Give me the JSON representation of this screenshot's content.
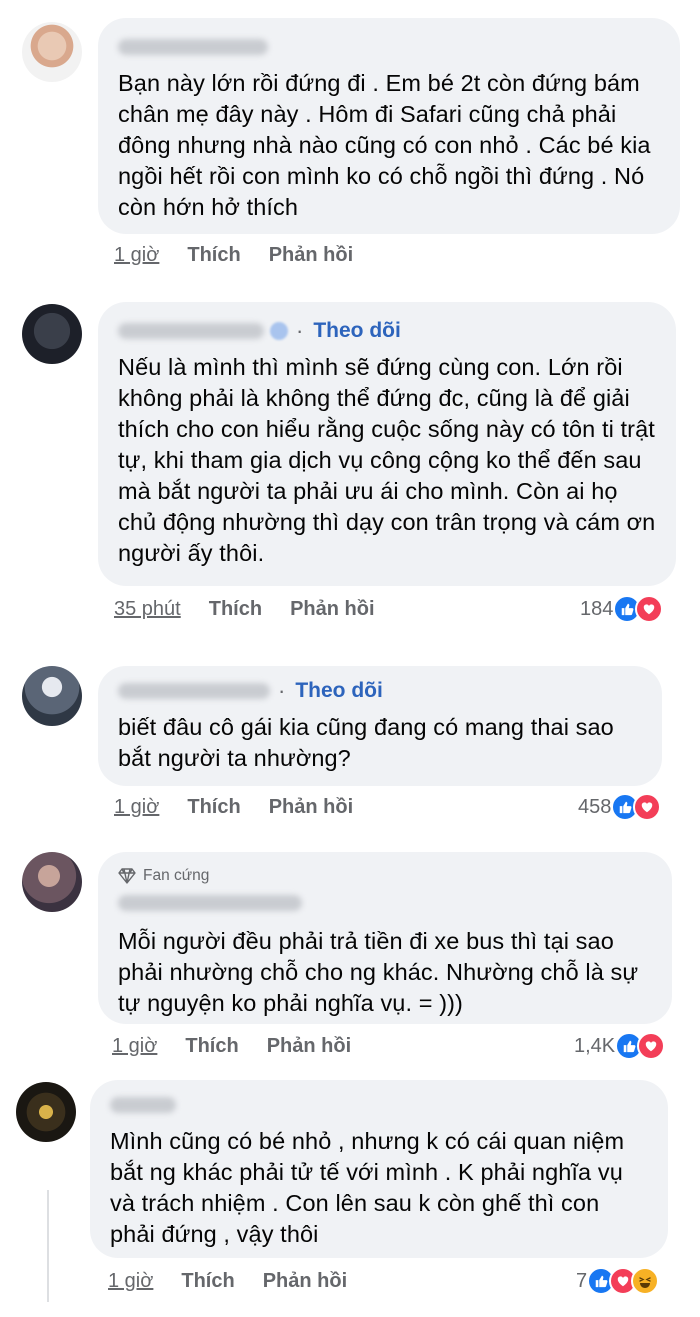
{
  "comments": [
    {
      "name": "",
      "follow": "",
      "badge": "",
      "text": "Bạn này lớn rồi đứng đi . Em bé 2t còn đứng bám chân mẹ đây này . Hôm đi Safari cũng chả phải đông nhưng nhà nào cũng có con nhỏ . Các bé kia ngồi hết rồi con mình ko có chỗ ngồi thì đứng . Nó còn hớn hở thích",
      "time": "1 giờ",
      "like_label": "Thích",
      "reply_label": "Phản hồi",
      "reaction_count": "",
      "reactions": []
    },
    {
      "name": "",
      "follow": "Theo dõi",
      "badge": "",
      "text": "Nếu là mình thì mình sẽ đứng cùng con. Lớn rồi không phải là không thể đứng đc, cũng là để giải thích cho con hiểu rằng cuộc sống này có tôn ti trật tự, khi tham gia dịch vụ công cộng ko thể đến sau mà bắt người ta phải ưu ái cho mình. Còn ai họ chủ động nhường thì dạy con trân trọng và cám ơn người ấy thôi.",
      "time": "35 phút",
      "like_label": "Thích",
      "reply_label": "Phản hồi",
      "reaction_count": "184",
      "reactions": [
        "like-icon",
        "love-icon"
      ]
    },
    {
      "name": "",
      "follow": "Theo dõi",
      "badge": "",
      "text": "biết đâu cô gái kia cũng đang có mang thai sao bắt người ta nhường?",
      "time": "1 giờ",
      "like_label": "Thích",
      "reply_label": "Phản hồi",
      "reaction_count": "458",
      "reactions": [
        "like-icon",
        "love-icon"
      ]
    },
    {
      "name": "",
      "follow": "",
      "badge": "Fan cứng",
      "text": "Mỗi người đều phải trả tiền đi xe bus thì tại sao phải nhường chỗ cho ng khác. Nhường chỗ là sự tự nguyện ko phải nghĩa vụ. = )))",
      "time": "1 giờ",
      "like_label": "Thích",
      "reply_label": "Phản hồi",
      "reaction_count": "1,4K",
      "reactions": [
        "like-icon",
        "love-icon"
      ]
    },
    {
      "name": "",
      "follow": "",
      "badge": "",
      "text": "Mình cũng có bé nhỏ , nhưng k có cái quan niệm bắt ng khác phải tử tế với mình . K phải nghĩa vụ và trách nhiệm . Con lên sau k còn ghế thì con phải đứng , vậy thôi",
      "time": "1 giờ",
      "like_label": "Thích",
      "reply_label": "Phản hồi",
      "reaction_count": "7",
      "reactions": [
        "like-icon",
        "love-icon",
        "haha-icon"
      ]
    }
  ],
  "colors": {
    "bubble": "#f0f2f5",
    "link": "#2d64bc",
    "meta": "#65676b",
    "like": "#1877f2",
    "love": "#f33e58",
    "haha": "#f7b125"
  }
}
